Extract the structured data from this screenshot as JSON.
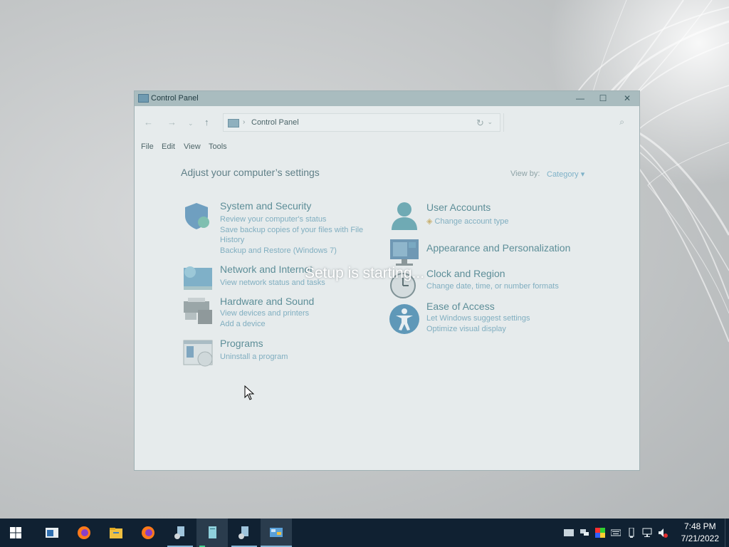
{
  "window": {
    "title": "Control Panel",
    "controls": {
      "minimize": "—",
      "maximize": "☐",
      "close": "✕"
    }
  },
  "address": {
    "path": "Control Panel",
    "search_placeholder": ""
  },
  "menu": [
    "File",
    "Edit",
    "View",
    "Tools"
  ],
  "content": {
    "heading": "Adjust your computer’s settings",
    "view_by_label": "View by:",
    "view_by_value": "Category",
    "categories": [
      {
        "title": "System and Security",
        "links": [
          "Review your computer's status",
          "Save backup copies of your files with File",
          "History",
          "Backup and Restore (Windows 7)"
        ],
        "icon": "shield-icon"
      },
      {
        "title": "Network and Internet",
        "links": [
          "View network status and tasks"
        ],
        "icon": "network-icon"
      },
      {
        "title": "Hardware and Sound",
        "links": [
          "View devices and printers",
          "Add a device"
        ],
        "icon": "printer-icon"
      },
      {
        "title": "Programs",
        "links": [
          "Uninstall a program"
        ],
        "icon": "programs-icon"
      },
      {
        "title": "User Accounts",
        "links": [
          "Change account type"
        ],
        "icon": "user-icon"
      },
      {
        "title": "Appearance and Personalization",
        "links": [],
        "icon": "monitor-icon"
      },
      {
        "title": "Clock and Region",
        "links": [
          "Change date, time, or number formats"
        ],
        "icon": "clock-icon"
      },
      {
        "title": "Ease of Access",
        "links": [
          "Let Windows suggest settings",
          "Optimize visual display"
        ],
        "icon": "accessibility-icon"
      }
    ]
  },
  "overlay": {
    "message": "Setup is starting..."
  },
  "taskbar": {
    "items": [
      "start-icon",
      "task-view-icon",
      "firefox-icon",
      "file-explorer-icon",
      "firefox-icon",
      "media-setup-icon",
      "document-icon",
      "media-setup-icon",
      "control-panel-icon"
    ],
    "tray_icons": [
      "action-center-icon",
      "network-share-icon",
      "color-icon",
      "keyboard-icon",
      "usb-icon",
      "network-icon",
      "volume-muted-icon"
    ],
    "clock_time": "7:48 PM",
    "clock_date": "7/21/2022"
  }
}
